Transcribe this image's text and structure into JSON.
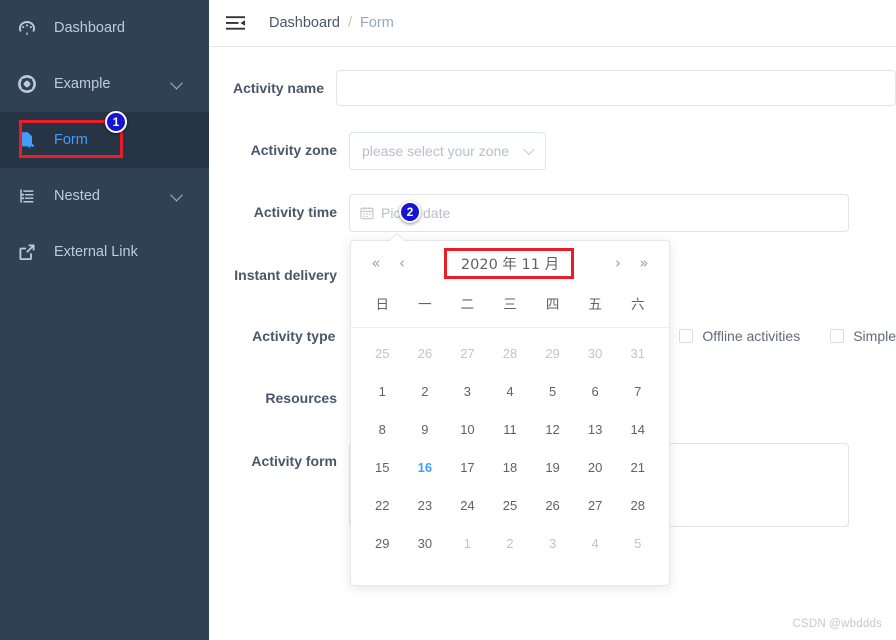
{
  "colors": {
    "sidebar_bg": "#304156",
    "sidebar_active_bg": "#263445",
    "accent_blue": "#409eff",
    "highlight_red": "#ec1c24",
    "badge_blue": "#1414d2"
  },
  "sidebar": {
    "items": [
      {
        "label": "Dashboard",
        "icon": "dashboard-gauge-icon",
        "active": false,
        "has_chevron": false
      },
      {
        "label": "Example",
        "icon": "lifebuoy-icon",
        "active": false,
        "has_chevron": true
      },
      {
        "label": "Form",
        "icon": "document-edit-icon",
        "active": true,
        "has_chevron": false
      },
      {
        "label": "Nested",
        "icon": "list-tree-icon",
        "active": false,
        "has_chevron": true
      },
      {
        "label": "External Link",
        "icon": "external-link-icon",
        "active": false,
        "has_chevron": false
      }
    ]
  },
  "header": {
    "hamburger_icon": "hamburger-collapse-icon",
    "breadcrumb": {
      "current": "Dashboard",
      "separator": "/",
      "sub": "Form"
    }
  },
  "annotations": {
    "badge_1": "1",
    "badge_2": "2"
  },
  "form": {
    "rows": [
      {
        "label": "Activity name",
        "type": "input"
      },
      {
        "label": "Activity zone",
        "type": "select"
      },
      {
        "label": "Activity time",
        "type": "date"
      },
      {
        "label": "Instant delivery",
        "type": "switch"
      },
      {
        "label": "Activity type",
        "type": "checkbox-group"
      },
      {
        "label": "Resources",
        "type": "radio-group"
      },
      {
        "label": "Activity form",
        "type": "textarea"
      }
    ],
    "activity_name": {
      "value": "",
      "placeholder": ""
    },
    "activity_zone": {
      "value": "",
      "placeholder": "please select your zone",
      "chevron_icon": "chevron-down-icon"
    },
    "activity_time": {
      "value": "",
      "placeholder": "Pick a date",
      "icon": "calendar-icon"
    },
    "activity_type": {
      "checkboxes": [
        {
          "label": "Offline activities",
          "checked": false
        },
        {
          "label": "Simple",
          "checked": false
        }
      ]
    },
    "activity_form": {
      "value": "",
      "placeholder": ""
    }
  },
  "datepicker": {
    "title": "2020 年  11 月",
    "nav": {
      "prev_year_icon": "chevron-double-left-icon",
      "prev_month_icon": "chevron-left-icon",
      "next_month_icon": "chevron-right-icon",
      "next_year_icon": "chevron-double-right-icon",
      "prev_year": "«",
      "prev_month": "‹",
      "next_month": "›",
      "next_year": "»"
    },
    "weekdays": [
      "日",
      "一",
      "二",
      "三",
      "四",
      "五",
      "六"
    ],
    "cells": [
      {
        "d": "25",
        "state": "muted"
      },
      {
        "d": "26",
        "state": "muted"
      },
      {
        "d": "27",
        "state": "muted"
      },
      {
        "d": "28",
        "state": "muted"
      },
      {
        "d": "29",
        "state": "muted"
      },
      {
        "d": "30",
        "state": "muted"
      },
      {
        "d": "31",
        "state": "muted"
      },
      {
        "d": "1",
        "state": "normal"
      },
      {
        "d": "2",
        "state": "normal"
      },
      {
        "d": "3",
        "state": "normal"
      },
      {
        "d": "4",
        "state": "normal"
      },
      {
        "d": "5",
        "state": "normal"
      },
      {
        "d": "6",
        "state": "normal"
      },
      {
        "d": "7",
        "state": "normal"
      },
      {
        "d": "8",
        "state": "normal"
      },
      {
        "d": "9",
        "state": "normal"
      },
      {
        "d": "10",
        "state": "normal"
      },
      {
        "d": "11",
        "state": "normal"
      },
      {
        "d": "12",
        "state": "normal"
      },
      {
        "d": "13",
        "state": "normal"
      },
      {
        "d": "14",
        "state": "normal"
      },
      {
        "d": "15",
        "state": "normal"
      },
      {
        "d": "16",
        "state": "today"
      },
      {
        "d": "17",
        "state": "normal"
      },
      {
        "d": "18",
        "state": "normal"
      },
      {
        "d": "19",
        "state": "normal"
      },
      {
        "d": "20",
        "state": "normal"
      },
      {
        "d": "21",
        "state": "normal"
      },
      {
        "d": "22",
        "state": "normal"
      },
      {
        "d": "23",
        "state": "normal"
      },
      {
        "d": "24",
        "state": "normal"
      },
      {
        "d": "25",
        "state": "normal"
      },
      {
        "d": "26",
        "state": "normal"
      },
      {
        "d": "27",
        "state": "normal"
      },
      {
        "d": "28",
        "state": "normal"
      },
      {
        "d": "29",
        "state": "normal"
      },
      {
        "d": "30",
        "state": "normal"
      },
      {
        "d": "1",
        "state": "muted"
      },
      {
        "d": "2",
        "state": "muted"
      },
      {
        "d": "3",
        "state": "muted"
      },
      {
        "d": "4",
        "state": "muted"
      },
      {
        "d": "5",
        "state": "muted"
      }
    ]
  },
  "watermark": "CSDN @wbddds"
}
